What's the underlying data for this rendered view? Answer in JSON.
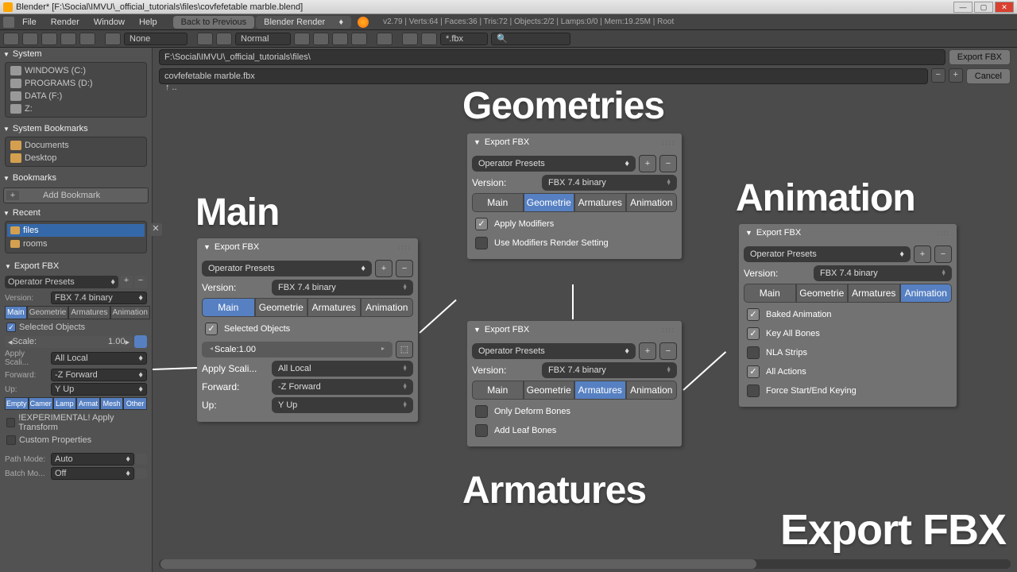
{
  "titlebar": {
    "title": "Blender* [F:\\Social\\IMVU\\_official_tutorials\\files\\covfefetable marble.blend]"
  },
  "menu": {
    "file": "File",
    "render": "Render",
    "window": "Window",
    "help": "Help",
    "back": "Back to Previous",
    "renderer": "Blender Render",
    "stats": "v2.79 | Verts:64 | Faces:36 | Tris:72 | Objects:2/2 | Lamps:0/0 | Mem:19.25M | Root"
  },
  "toolbar2": {
    "none": "None",
    "normal": "Normal",
    "filter": "*.fbx"
  },
  "path": {
    "dir": "F:\\Social\\IMVU\\_official_tutorials\\files\\",
    "file": "covfefetable marble.fbx",
    "export": "Export FBX",
    "cancel": "Cancel",
    "up": "↑ .."
  },
  "sidebar": {
    "system": "System",
    "drives": [
      "WINDOWS (C:)",
      "PROGRAMS (D:)",
      "DATA (F:)",
      "Z:"
    ],
    "sys_bookmarks": "System Bookmarks",
    "sb_items": [
      "Documents",
      "Desktop"
    ],
    "bookmarks": "Bookmarks",
    "add_bookmark": "Add Bookmark",
    "recent": "Recent",
    "recent_items": [
      "files",
      "rooms"
    ]
  },
  "efbx": {
    "title": "Export FBX",
    "presets": "Operator Presets",
    "version_lbl": "Version:",
    "version": "FBX 7.4 binary",
    "tabs": [
      "Main",
      "Geometrie",
      "Armatures",
      "Animation"
    ],
    "selected": "Selected Objects",
    "scale_lbl": "Scale:",
    "scale": "1.00",
    "apply_scaling_lbl": "Apply Scali...",
    "apply_scaling": "All Local",
    "forward_lbl": "Forward:",
    "forward": "-Z Forward",
    "up_lbl": "Up:",
    "up": "Y Up",
    "types": [
      "Empty",
      "Camer",
      "Lamp",
      "Armat",
      "Mesh",
      "Other"
    ],
    "exp_transform": "!EXPERIMENTAL! Apply Transform",
    "custom_props": "Custom Properties",
    "pathmode_lbl": "Path Mode:",
    "pathmode": "Auto",
    "batchmode_lbl": "Batch Mo...",
    "batchmode": "Off"
  },
  "overlay": {
    "main": "Main",
    "geometries": "Geometries",
    "armatures": "Armatures",
    "animation": "Animation",
    "export": "Export FBX"
  },
  "p_main": {
    "title": "Export FBX",
    "presets": "Operator Presets",
    "version_lbl": "Version:",
    "version": "FBX 7.4 binary",
    "tabs": [
      "Main",
      "Geometrie",
      "Armatures",
      "Animation"
    ],
    "selected": "Selected Objects",
    "scale_lbl": "Scale:",
    "scale_val": "1.00",
    "apply_lbl": "Apply Scali...",
    "apply": "All Local",
    "fwd_lbl": "Forward:",
    "fwd": "-Z Forward",
    "up_lbl": "Up:",
    "up": "Y Up"
  },
  "p_geo": {
    "title": "Export FBX",
    "presets": "Operator Presets",
    "version_lbl": "Version:",
    "version": "FBX 7.4 binary",
    "tabs": [
      "Main",
      "Geometrie",
      "Armatures",
      "Animation"
    ],
    "apply_mods": "Apply Modifiers",
    "use_mods": "Use Modifiers Render Setting"
  },
  "p_arm": {
    "title": "Export FBX",
    "presets": "Operator Presets",
    "version_lbl": "Version:",
    "version": "FBX 7.4 binary",
    "tabs": [
      "Main",
      "Geometrie",
      "Armatures",
      "Animation"
    ],
    "deform": "Only Deform Bones",
    "leaf": "Add Leaf Bones"
  },
  "p_anim": {
    "title": "Export FBX",
    "presets": "Operator Presets",
    "version_lbl": "Version:",
    "version": "FBX 7.4 binary",
    "tabs": [
      "Main",
      "Geometrie",
      "Armatures",
      "Animation"
    ],
    "baked": "Baked Animation",
    "keyall": "Key All Bones",
    "nla": "NLA Strips",
    "allact": "All Actions",
    "force": "Force Start/End Keying"
  }
}
